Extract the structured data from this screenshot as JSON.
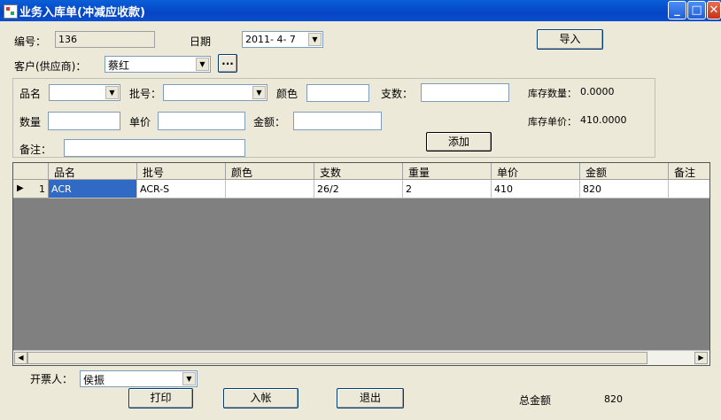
{
  "window": {
    "title": "业务入库单(冲减应收款)",
    "minimize": "_",
    "maximize": "□",
    "close": "✕"
  },
  "header": {
    "code_label": "编号：",
    "code_value": "136",
    "date_label": "日期",
    "date_value": "2011- 4- 7",
    "import_button": "导入",
    "customer_label": "客户(供应商)：",
    "customer_value": "蔡红",
    "browse_button": "..."
  },
  "entry": {
    "name_label": "品名",
    "name_value": "",
    "batch_label": "批号：",
    "batch_value": "",
    "color_label": "颜色",
    "color_value": "",
    "count_label": "支数：",
    "count_value": "",
    "stock_qty_label": "库存数量：",
    "stock_qty_value": "0.0000",
    "qty_label": "数量",
    "qty_value": "",
    "unit_price_label": "单价",
    "unit_price_value": "",
    "amount_label": "金额：",
    "amount_value": "",
    "stock_price_label": "库存单价：",
    "stock_price_value": "410.0000",
    "remark_label": "备注：",
    "remark_value": "",
    "add_button": "添加"
  },
  "grid": {
    "columns": [
      "品名",
      "批号",
      "颜色",
      "支数",
      "重量",
      "单价",
      "金额",
      "备注"
    ],
    "rows": [
      {
        "index": "1",
        "cells": [
          "ACR",
          "ACR-S",
          "",
          "26/2",
          "2",
          "410",
          "820",
          ""
        ]
      }
    ]
  },
  "footer": {
    "invoicer_label": "开票人：",
    "invoicer_value": "侯振",
    "print_button": "打印",
    "post_button": "入帐",
    "exit_button": "退出",
    "total_label": "总金额",
    "total_value": "820"
  },
  "icons": {
    "dropdown": "▼",
    "row_pointer": "▶",
    "scroll_left": "◀",
    "scroll_right": "▶"
  }
}
